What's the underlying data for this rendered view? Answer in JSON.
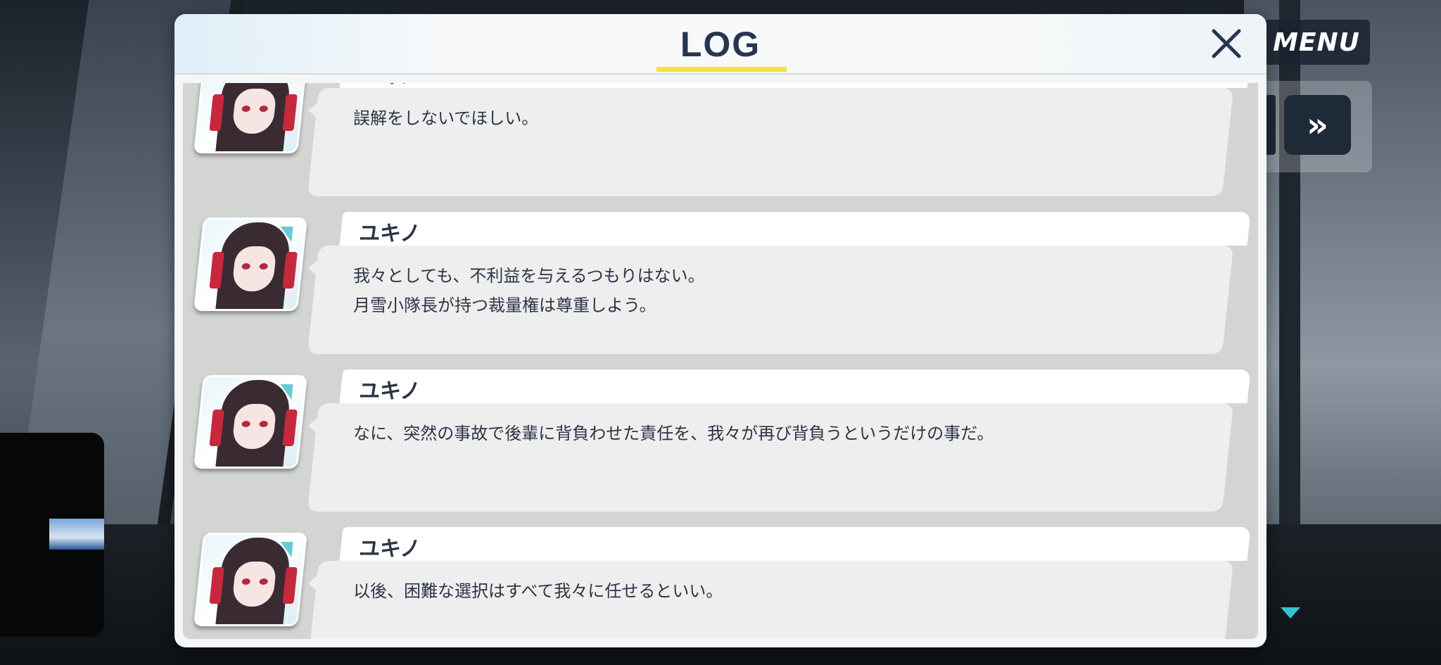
{
  "header": {
    "title": "LOG"
  },
  "controls": {
    "menu_label": "MENU",
    "skip_label": "»"
  },
  "log": [
    {
      "speaker": "ユキノ",
      "text": "誤解をしないでほしい。"
    },
    {
      "speaker": "ユキノ",
      "text": "我々としても、不利益を与えるつもりはない。\n月雪小隊長が持つ裁量権は尊重しよう。"
    },
    {
      "speaker": "ユキノ",
      "text": "なに、突然の事故で後輩に背負わせた責任を、我々が再び背負うというだけの事だ。"
    },
    {
      "speaker": "ユキノ",
      "text": "以後、困難な選択はすべて我々に任せるといい。"
    }
  ]
}
